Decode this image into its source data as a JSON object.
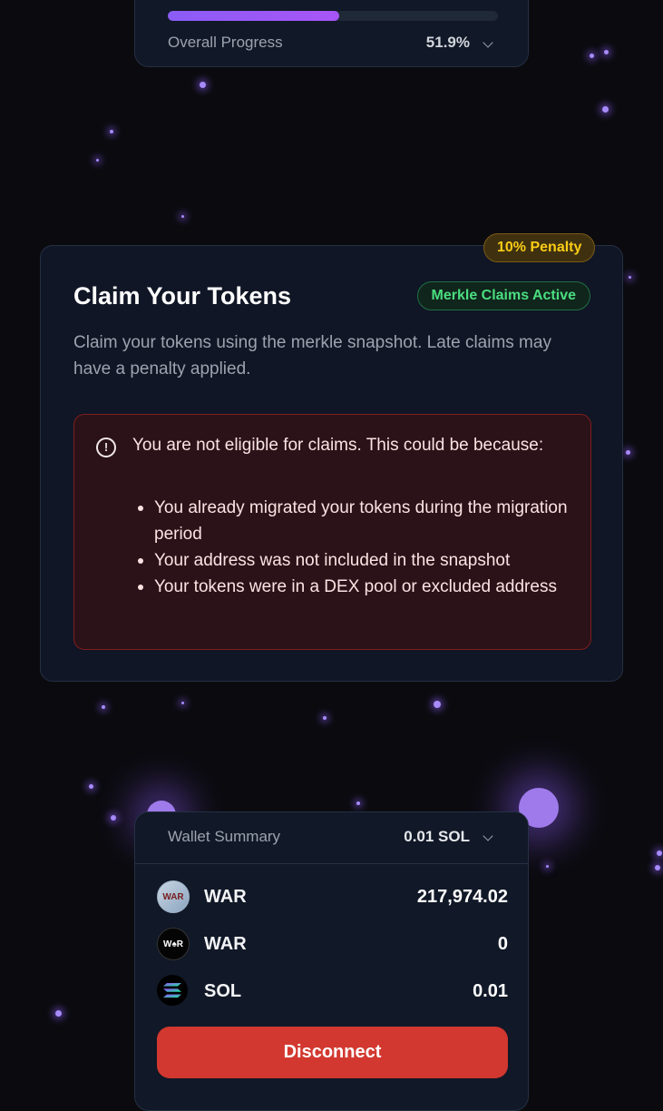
{
  "progress": {
    "label": "Overall Progress",
    "value": "51.9%",
    "fraction": 0.519
  },
  "claim": {
    "title": "Claim Your Tokens",
    "penalty_badge": "10% Penalty",
    "status_badge": "Merkle Claims Active",
    "description": "Claim your tokens using the merkle snapshot. Late claims may have a penalty applied.",
    "alert": {
      "icon": "alert-circle-icon",
      "message": "You are not eligible for claims. This could be because:",
      "reasons": [
        "You already migrated your tokens during the migration period",
        "Your address was not included in the snapshot",
        "Your tokens were in a DEX pool or excluded address"
      ]
    }
  },
  "wallet": {
    "title": "Wallet Summary",
    "total": "0.01 SOL",
    "tokens": [
      {
        "symbol": "WAR",
        "amount": "217,974.02",
        "icon": "war-token-logo-light"
      },
      {
        "symbol": "WAR",
        "amount": "0",
        "icon": "war-token-logo-dark"
      },
      {
        "symbol": "SOL",
        "amount": "0.01",
        "icon": "solana-logo"
      }
    ],
    "disconnect_label": "Disconnect"
  },
  "colors": {
    "accent": "#8b5cf6",
    "danger": "#d2382f",
    "success": "#4ade80",
    "warning": "#facc15"
  }
}
